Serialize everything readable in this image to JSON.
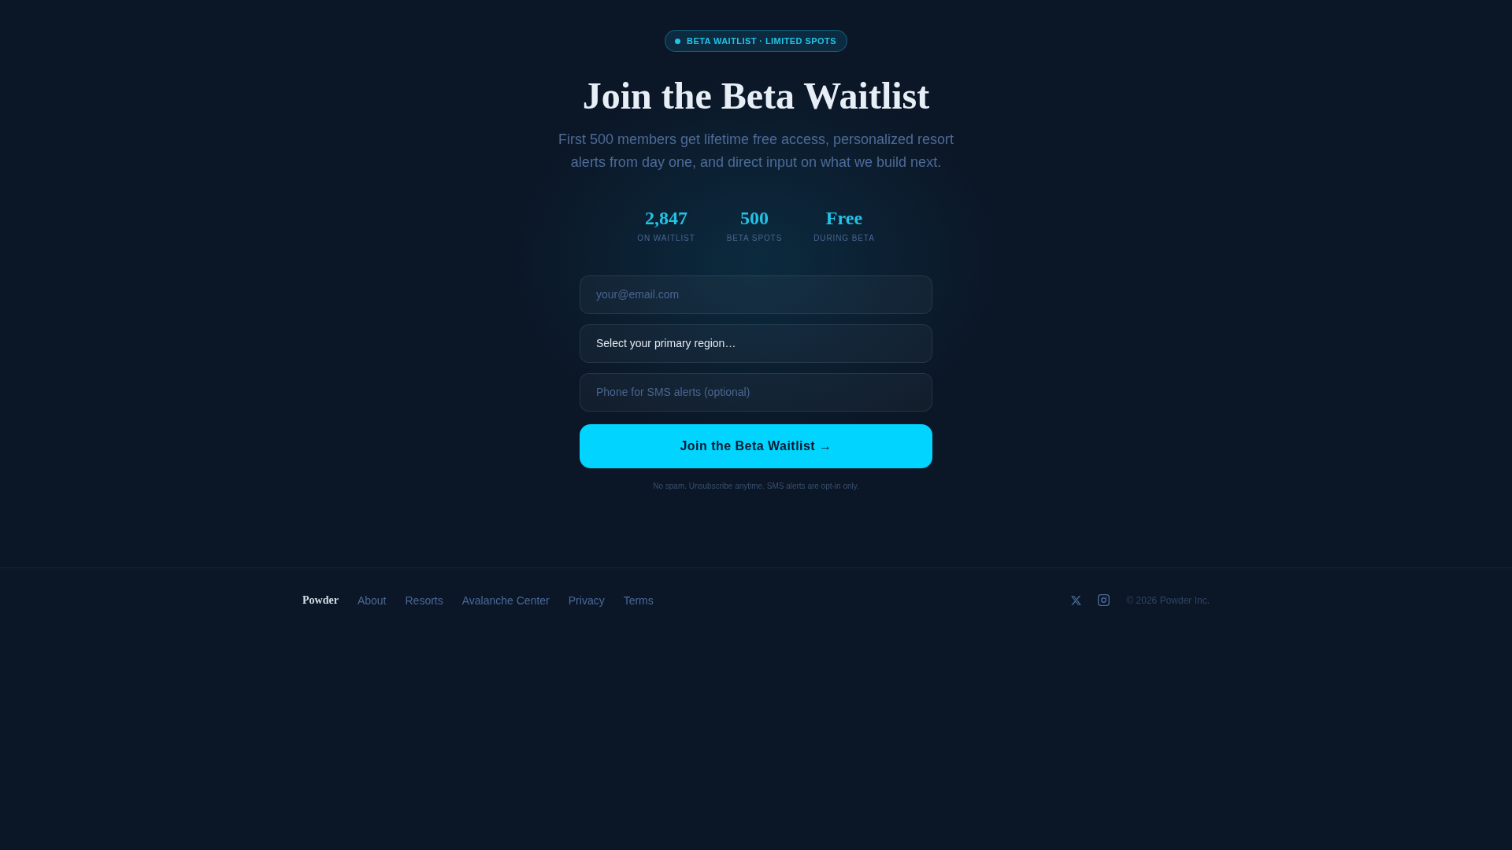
{
  "badge": {
    "label": "BETA WAITLIST · LIMITED SPOTS"
  },
  "hero": {
    "title": "Join the Beta Waitlist",
    "subtitle": "First 500 members get lifetime free access, personalized resort alerts from day one, and direct input on what we build next."
  },
  "stats": [
    {
      "value": "2,847",
      "label": "ON WAITLIST"
    },
    {
      "value": "500",
      "label": "BETA SPOTS"
    },
    {
      "value": "Free",
      "label": "DURING BETA"
    }
  ],
  "form": {
    "fields": [
      {
        "kind": "input",
        "placeholder": "your@email.com"
      },
      {
        "kind": "select",
        "value": "Select your primary region…"
      },
      {
        "kind": "input",
        "placeholder": "Phone for SMS alerts (optional)"
      }
    ],
    "submit": "Join the Beta Waitlist →",
    "note": "No spam. Unsubscribe anytime. SMS alerts are opt-in only."
  },
  "footer": {
    "brand": "Powder",
    "links": [
      "About",
      "Resorts",
      "Avalanche Center",
      "Privacy",
      "Terms"
    ],
    "copyright": "© 2026 Powder Inc."
  }
}
